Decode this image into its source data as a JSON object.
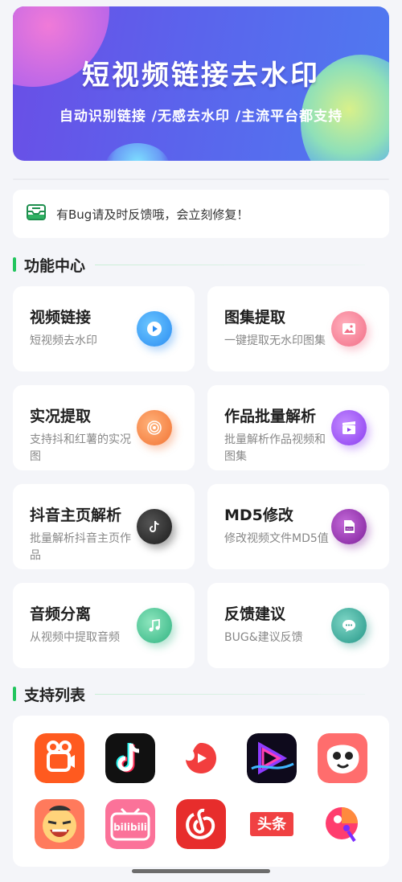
{
  "banner": {
    "title": "短视频链接去水印",
    "subtitle": "自动识别链接 /无感去水印 /主流平台都支持"
  },
  "notice": {
    "icon": "inbox-icon",
    "text": "有Bug请及时反馈哦，会立刻修复！"
  },
  "sections": {
    "features_title": "功能中心",
    "support_title": "支持列表"
  },
  "features": [
    {
      "title": "视频链接",
      "desc": "短视频去水印",
      "icon": "play-icon",
      "color": "#3b9cf5"
    },
    {
      "title": "图集提取",
      "desc": "一键提取无水印图集",
      "icon": "image-icon",
      "color": "#f4798f"
    },
    {
      "title": "实况提取",
      "desc": "支持抖和红薯的实况图",
      "icon": "live-icon",
      "color": "#f5823c"
    },
    {
      "title": "作品批量解析",
      "desc": "批量解析作品视频和图集",
      "icon": "clapper-icon",
      "color": "#9b4ff0"
    },
    {
      "title": "抖音主页解析",
      "desc": "批量解析抖音主页作品",
      "icon": "tiktok-icon",
      "color": "#2b2b2b"
    },
    {
      "title": "MD5修改",
      "desc": "修改视频文件MD5值",
      "icon": "md5-file-icon",
      "color": "#8d2fa8"
    },
    {
      "title": "音频分离",
      "desc": "从视频中提取音频",
      "icon": "music-note-icon",
      "color": "#3dbd8d"
    },
    {
      "title": "反馈建议",
      "desc": "BUG&建议反馈",
      "icon": "chat-bubble-icon",
      "color": "#2aa594"
    }
  ],
  "platforms": [
    {
      "name": "kuaishou-app-icon"
    },
    {
      "name": "douyin-app-icon"
    },
    {
      "name": "weishi-app-icon"
    },
    {
      "name": "video-player-app-icon"
    },
    {
      "name": "pipixia-app-icon"
    },
    {
      "name": "zuiyou-app-icon"
    },
    {
      "name": "bilibili-app-icon",
      "label": "bilibili"
    },
    {
      "name": "netease-music-app-icon"
    },
    {
      "name": "toutiao-app-icon",
      "label": "头条"
    },
    {
      "name": "meitu-app-icon"
    }
  ]
}
